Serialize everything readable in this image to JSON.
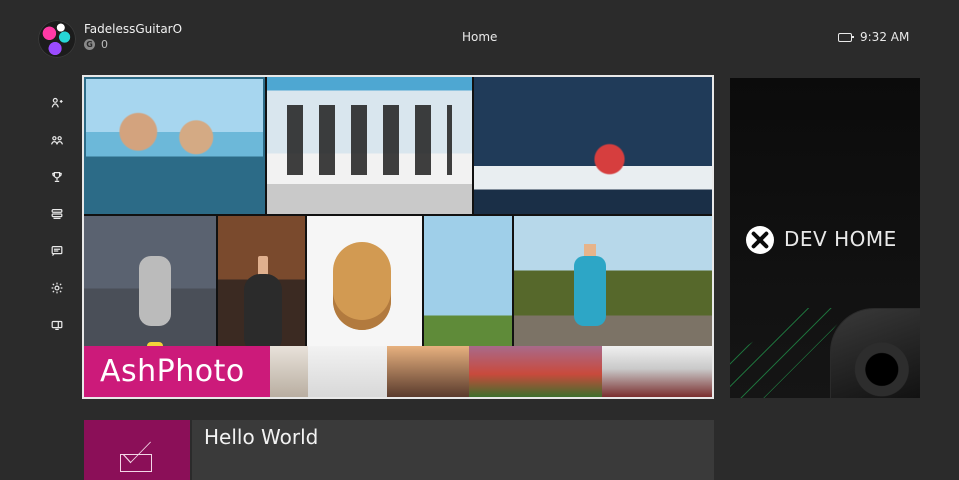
{
  "header": {
    "gamertag": "FadelessGuitarO",
    "gamerscore": "0",
    "gamerscore_icon": "G",
    "page_title": "Home",
    "time": "9:32 AM",
    "status_icon": "controller-battery-icon"
  },
  "left_rail": {
    "items": [
      {
        "icon": "friends-icon"
      },
      {
        "icon": "party-icon"
      },
      {
        "icon": "achievements-icon"
      },
      {
        "icon": "apps-icon"
      },
      {
        "icon": "messages-icon"
      },
      {
        "icon": "settings-icon"
      },
      {
        "icon": "snap-icon"
      }
    ]
  },
  "pins": {
    "main_tile_label": "AshPhoto",
    "dev_home_label": "DEV HOME",
    "hello_tile_label": "Hello World"
  },
  "colors": {
    "background": "#2b2b2b",
    "accent_magenta": "#cc1a7a",
    "mail_tile": "#8b0f58",
    "hello_tile": "#3a3a3a",
    "dev_tile": "#0b0b0b",
    "dev_green": "#26c860"
  }
}
